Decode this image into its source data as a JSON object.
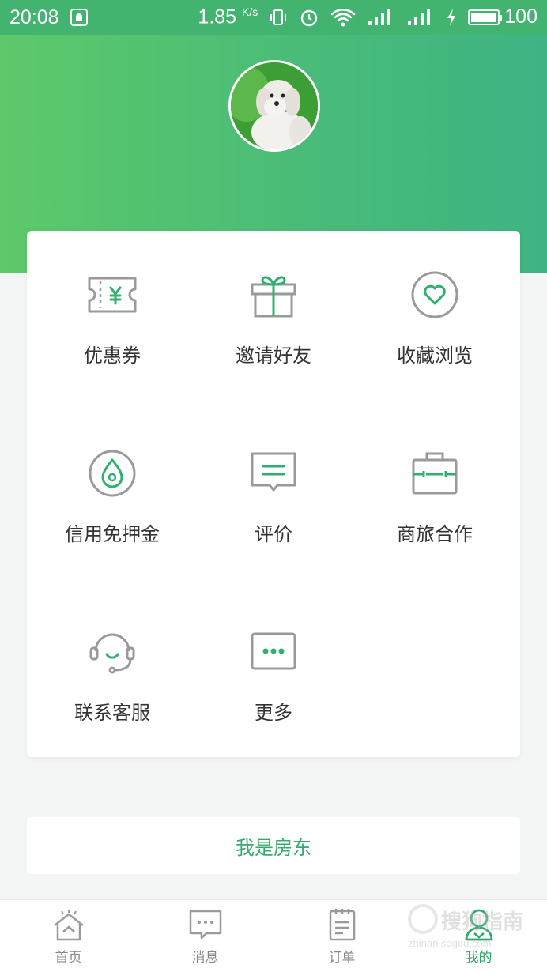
{
  "status_bar": {
    "time": "20:08",
    "speed": "1.85",
    "speed_unit": "K/s",
    "battery": "100"
  },
  "menu": {
    "items": [
      {
        "label": "优惠券",
        "icon": "coupon-icon"
      },
      {
        "label": "邀请好友",
        "icon": "gift-icon"
      },
      {
        "label": "收藏浏览",
        "icon": "heart-icon"
      },
      {
        "label": "信用免押金",
        "icon": "deposit-icon"
      },
      {
        "label": "评价",
        "icon": "comment-icon"
      },
      {
        "label": "商旅合作",
        "icon": "briefcase-icon"
      },
      {
        "label": "联系客服",
        "icon": "headset-icon"
      },
      {
        "label": "更多",
        "icon": "more-icon"
      }
    ]
  },
  "landlord_label": "我是房东",
  "bottom_nav": {
    "items": [
      {
        "label": "首页",
        "icon": "home-icon",
        "active": false
      },
      {
        "label": "消息",
        "icon": "message-icon",
        "active": false
      },
      {
        "label": "订单",
        "icon": "order-icon",
        "active": false
      },
      {
        "label": "我的",
        "icon": "profile-icon",
        "active": true
      }
    ]
  },
  "watermark": {
    "text": "搜狗指南",
    "url": "zhinan.sogou.com"
  },
  "colors": {
    "accent": "#3fb37a",
    "gradient_start": "#5dc96a",
    "gradient_end": "#3fb384",
    "icon_gray": "#9a9a9a"
  }
}
